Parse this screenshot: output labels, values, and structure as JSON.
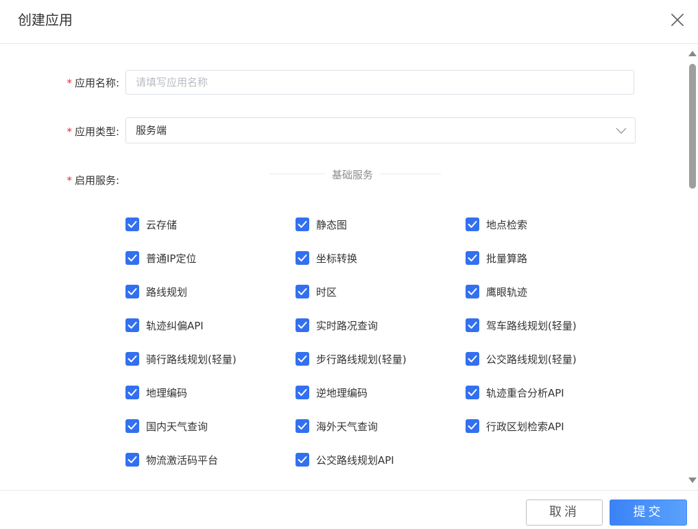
{
  "dialog": {
    "title": "创建应用",
    "close_icon": "close-icon"
  },
  "form": {
    "name": {
      "required_mark": "*",
      "label": "应用名称:",
      "placeholder": "请填写应用名称",
      "value": ""
    },
    "type": {
      "required_mark": "*",
      "label": "应用类型:",
      "selected": "服务端",
      "icon": "chevron-down-icon"
    },
    "services": {
      "required_mark": "*",
      "label": "启用服务:",
      "group_title": "基础服务",
      "items": [
        {
          "label": "云存储",
          "checked": true
        },
        {
          "label": "静态图",
          "checked": true
        },
        {
          "label": "地点检索",
          "checked": true
        },
        {
          "label": "普通IP定位",
          "checked": true
        },
        {
          "label": "坐标转换",
          "checked": true
        },
        {
          "label": "批量算路",
          "checked": true
        },
        {
          "label": "路线规划",
          "checked": true
        },
        {
          "label": "时区",
          "checked": true
        },
        {
          "label": "鹰眼轨迹",
          "checked": true
        },
        {
          "label": "轨迹纠偏API",
          "checked": true
        },
        {
          "label": "实时路况查询",
          "checked": true
        },
        {
          "label": "驾车路线规划(轻量)",
          "checked": true
        },
        {
          "label": "骑行路线规划(轻量)",
          "checked": true
        },
        {
          "label": "步行路线规划(轻量)",
          "checked": true
        },
        {
          "label": "公交路线规划(轻量)",
          "checked": true
        },
        {
          "label": "地理编码",
          "checked": true
        },
        {
          "label": "逆地理编码",
          "checked": true
        },
        {
          "label": "轨迹重合分析API",
          "checked": true
        },
        {
          "label": "国内天气查询",
          "checked": true
        },
        {
          "label": "海外天气查询",
          "checked": true
        },
        {
          "label": "行政区划检索API",
          "checked": true
        },
        {
          "label": "物流激活码平台",
          "checked": true
        },
        {
          "label": "公交路线规划API",
          "checked": true
        }
      ]
    }
  },
  "footer": {
    "cancel_label": "取消",
    "submit_label": "提交"
  },
  "colors": {
    "accent": "#3270f0",
    "required": "#f5222d",
    "submit_gradient_start": "#3a82f6",
    "submit_gradient_end": "#5aa2fb"
  }
}
